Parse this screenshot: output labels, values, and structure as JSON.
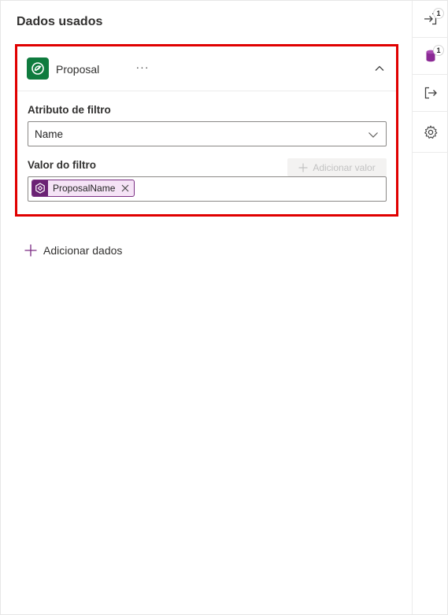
{
  "panel": {
    "title": "Dados usados"
  },
  "card": {
    "entity_name": "Proposal",
    "more_label": "···",
    "filter_attribute_label": "Atributo de filtro",
    "filter_attribute_value": "Name",
    "filter_value_label": "Valor do filtro",
    "add_value_label": "Adicionar valor",
    "token_label": "ProposalName"
  },
  "add_data_label": "Adicionar dados",
  "rail": {
    "items": [
      {
        "icon": "sign-in-icon",
        "badge": "1"
      },
      {
        "icon": "database-icon",
        "badge": "1"
      },
      {
        "icon": "sign-out-icon",
        "badge": ""
      },
      {
        "icon": "gear-icon",
        "badge": ""
      }
    ]
  },
  "colors": {
    "highlight_border": "#e00000",
    "entity_icon_bg": "#0f7b3e",
    "token_bg": "#f5e3f6",
    "token_accent": "#6b2374"
  }
}
